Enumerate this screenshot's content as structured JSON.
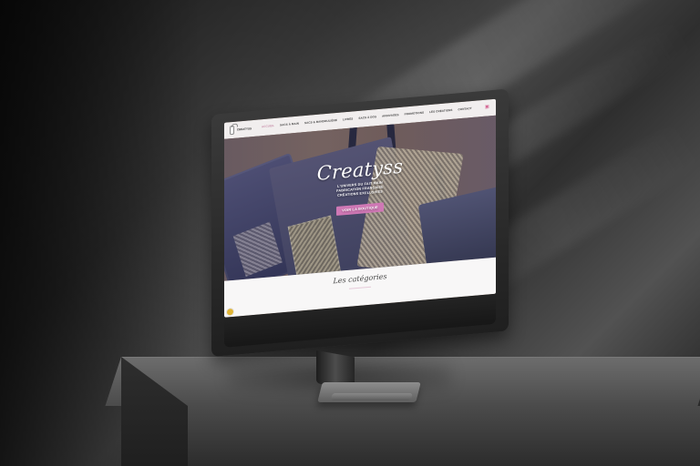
{
  "site": {
    "logo_text": "CREATYSS",
    "nav": [
      "ACCUEIL",
      "SACS À MAIN",
      "SACS & BANDOULIÈRE",
      "LIVRES",
      "SACS À DOS",
      "ARRIVAGES",
      "PROMOTIONS",
      "LES CRÉATIONS",
      "CONTACT"
    ],
    "hero": {
      "title": "Creatyss",
      "lines": [
        "L'UNIVERS DU FAIT MAIN",
        "FABRICATION FRANÇAISE",
        "CRÉATIONS EXCLUSIVES"
      ],
      "cta": "VOIR LA BOUTIQUE"
    },
    "categories_title": "Les catégories"
  },
  "colors": {
    "accent_pink": "#cf78b5",
    "cart_pink": "#d25c8c",
    "badge_yellow": "#e0b536"
  },
  "icons": {
    "cart": "shopping-cart-icon",
    "badge": "yellow-badge-icon"
  }
}
